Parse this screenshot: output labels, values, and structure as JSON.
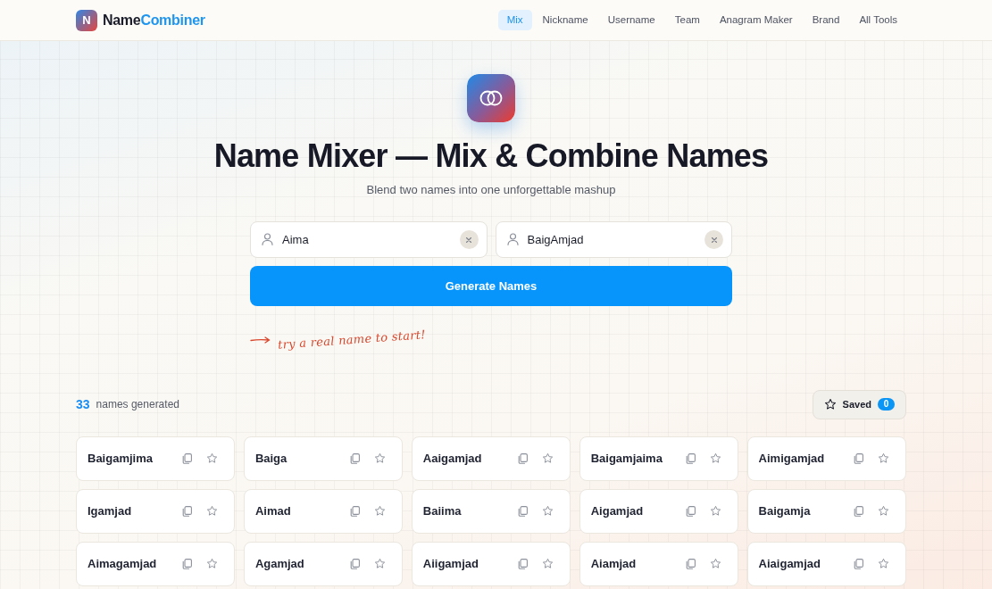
{
  "header": {
    "logo": {
      "letter": "N",
      "name_first": "Name",
      "name_second": "Combiner"
    },
    "nav": [
      {
        "label": "Mix",
        "selected": true
      },
      {
        "label": "Nickname",
        "selected": false
      },
      {
        "label": "Username",
        "selected": false
      },
      {
        "label": "Team",
        "selected": false
      },
      {
        "label": "Anagram Maker",
        "selected": false
      },
      {
        "label": "Brand",
        "selected": false
      },
      {
        "label": "All Tools",
        "selected": false
      }
    ]
  },
  "hero": {
    "title": "Name Mixer — Mix & Combine Names",
    "subtitle": "Blend two names into one unforgettable mashup"
  },
  "inputs": [
    {
      "value": "Aima"
    },
    {
      "value": "BaigAmjad"
    }
  ],
  "generate_button": "Generate Names",
  "hint": "try a real name to start!",
  "results": {
    "count": "33",
    "count_label": "names generated",
    "saved": {
      "label": "Saved",
      "count": "0"
    },
    "names": [
      {
        "name": "Baigamjima",
        "saved": false
      },
      {
        "name": "Baiga",
        "saved": false
      },
      {
        "name": "Aaigamjad",
        "saved": false
      },
      {
        "name": "Baigamjaima",
        "saved": false
      },
      {
        "name": "Aimigamjad",
        "saved": false
      },
      {
        "name": "Igamjad",
        "saved": false
      },
      {
        "name": "Aimad",
        "saved": false
      },
      {
        "name": "Baiima",
        "saved": false
      },
      {
        "name": "Aigamjad",
        "saved": false
      },
      {
        "name": "Baigamja",
        "saved": false
      },
      {
        "name": "Aimagamjad",
        "saved": false
      },
      {
        "name": "Agamjad",
        "saved": false
      },
      {
        "name": "Aiigamjad",
        "saved": false
      },
      {
        "name": "Aiamjad",
        "saved": false
      },
      {
        "name": "Aiaigamjad",
        "saved": false
      }
    ]
  }
}
